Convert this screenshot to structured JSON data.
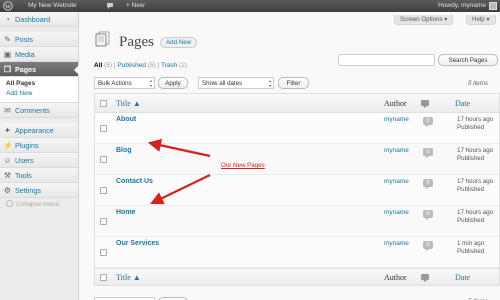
{
  "admin_bar": {
    "site_name": "My New Website",
    "new_label": "+ New",
    "howdy": "Howdy, myname"
  },
  "sidebar": {
    "items": [
      {
        "label": "Dashboard",
        "icon": "dashboard-icon"
      },
      {
        "label": "Posts",
        "icon": "posts-icon"
      },
      {
        "label": "Media",
        "icon": "media-icon"
      },
      {
        "label": "Pages",
        "icon": "pages-icon",
        "current": true
      },
      {
        "label": "Comments",
        "icon": "comments-icon"
      },
      {
        "label": "Appearance",
        "icon": "appearance-icon"
      },
      {
        "label": "Plugins",
        "icon": "plugins-icon"
      },
      {
        "label": "Users",
        "icon": "users-icon"
      },
      {
        "label": "Tools",
        "icon": "tools-icon"
      },
      {
        "label": "Settings",
        "icon": "settings-icon"
      }
    ],
    "submenu": [
      "All Pages",
      "Add New"
    ],
    "collapse_label": "Collapse menu"
  },
  "header": {
    "screen_options": "Screen Options ▾",
    "help": "Help ▾",
    "title": "Pages",
    "add_new": "Add New"
  },
  "filters": {
    "all": "All",
    "all_count": "(5)",
    "published": "Published",
    "published_count": "(5)",
    "trash": "Trash",
    "trash_count": "(2)",
    "sep": "|"
  },
  "search": {
    "button": "Search Pages",
    "value": ""
  },
  "tablenav": {
    "bulk_actions": "Bulk Actions",
    "apply": "Apply",
    "dates": "Show all dates",
    "filter": "Filter",
    "count": "5 items"
  },
  "table": {
    "columns": {
      "title": "Title ▲",
      "author": "Author",
      "date": "Date"
    },
    "rows": [
      {
        "title": "About",
        "author": "myname",
        "comments": "0",
        "date": "17 hours ago\nPublished"
      },
      {
        "title": "Blog",
        "author": "myname",
        "comments": "0",
        "date": "17 hours ago\nPublished"
      },
      {
        "title": "Contact Us",
        "author": "myname",
        "comments": "0",
        "date": "17 hours ago\nPublished"
      },
      {
        "title": "Home",
        "author": "myname",
        "comments": "0",
        "date": "17 hours ago\nPublished"
      },
      {
        "title": "Our Services",
        "author": "myname",
        "comments": "0",
        "date": "1 min ago\nPublished"
      }
    ]
  },
  "annotation": {
    "text": "Our New Pages",
    "color": "#d3241a"
  }
}
